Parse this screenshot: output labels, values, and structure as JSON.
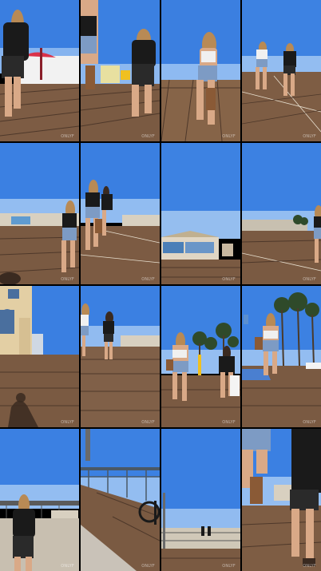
{
  "contact_sheet": {
    "rows": 4,
    "columns": 4,
    "frames": [
      {
        "scene": "boardwalk-walkers-close",
        "watermark": "ONLYF"
      },
      {
        "scene": "boardwalk-walker-left",
        "watermark": "ONLYF"
      },
      {
        "scene": "boardwalk-walker-center",
        "watermark": "ONLYF"
      },
      {
        "scene": "boardwalk-pair-far",
        "watermark": "ONLYF"
      },
      {
        "scene": "boardwalk-wide-left",
        "watermark": "ONLYF"
      },
      {
        "scene": "boardwalk-pair-center",
        "watermark": "ONLYF"
      },
      {
        "scene": "boardwalk-shops",
        "watermark": "ONLYF"
      },
      {
        "scene": "boardwalk-walker-right-edge",
        "watermark": "ONLYF"
      },
      {
        "scene": "pier-building-shadow",
        "watermark": "ONLYF"
      },
      {
        "scene": "pier-pair-distance",
        "watermark": "ONLYF"
      },
      {
        "scene": "pier-palms-pair",
        "watermark": "ONLYF"
      },
      {
        "scene": "pier-palms-walker",
        "watermark": "ONLYF"
      },
      {
        "scene": "pier-lower-walkway",
        "watermark": "ONLYF"
      },
      {
        "scene": "pier-railing-bicycle",
        "watermark": "ONLYF"
      },
      {
        "scene": "pier-far-railing",
        "watermark": "ONLYF"
      },
      {
        "scene": "pier-closeup-legs",
        "watermark": "ONLYF"
      }
    ]
  },
  "colors": {
    "sky_top": "#2f6fd8",
    "sky_bottom": "#8fbaf0",
    "boardwalk": "#7a5a42",
    "boardwalk_dark": "#5b4231",
    "plank_line": "#4e382a",
    "skin": "#d9a987",
    "black_top": "#1a1a1a",
    "denim": "#7d9bc4",
    "hair": "#b88a55",
    "palm": "#2f4a2a"
  }
}
